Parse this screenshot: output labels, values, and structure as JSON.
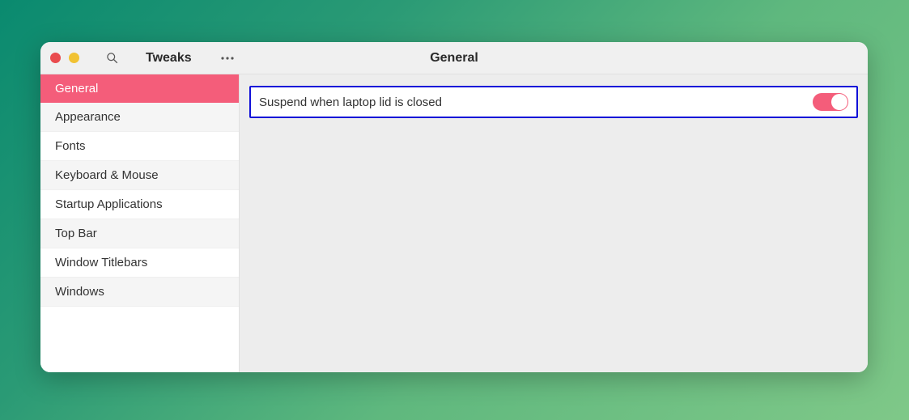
{
  "window": {
    "app_title": "Tweaks",
    "page_title": "General"
  },
  "sidebar": {
    "items": [
      {
        "label": "General",
        "active": true
      },
      {
        "label": "Appearance",
        "active": false
      },
      {
        "label": "Fonts",
        "active": false
      },
      {
        "label": "Keyboard & Mouse",
        "active": false
      },
      {
        "label": "Startup Applications",
        "active": false
      },
      {
        "label": "Top Bar",
        "active": false
      },
      {
        "label": "Window Titlebars",
        "active": false
      },
      {
        "label": "Windows",
        "active": false
      }
    ]
  },
  "settings": {
    "suspend_lid": {
      "label": "Suspend when laptop lid is closed",
      "value": true,
      "highlighted": true
    }
  },
  "colors": {
    "accent": "#f45d7a",
    "highlight_border": "#1010d8"
  }
}
